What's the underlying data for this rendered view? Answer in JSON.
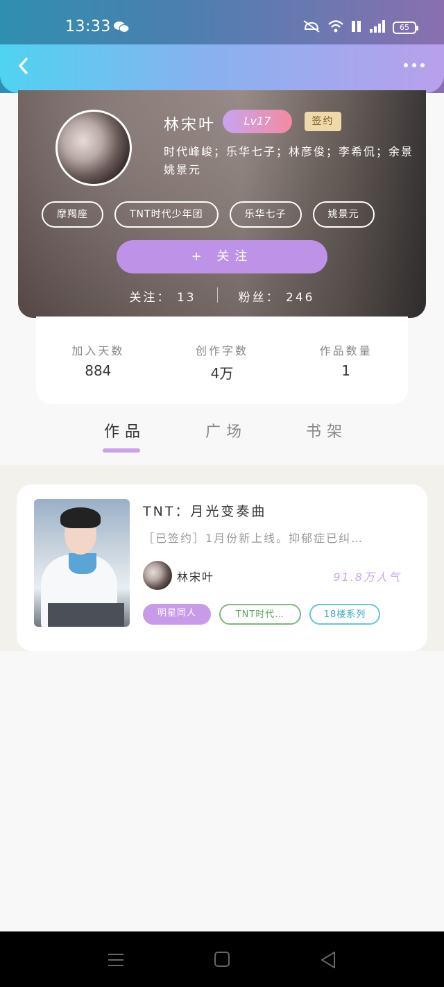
{
  "status_bar": {
    "time": "13:33",
    "battery": "65"
  },
  "profile": {
    "name": "林宋叶",
    "level": "Lv17",
    "sign_badge": "签约",
    "bio_line1": "时代峰峻；乐华七子；林彦俊；李希侃；余景",
    "bio_line2": "姚景元",
    "tags": [
      "摩羯座",
      "TNT时代少年团",
      "乐华七子",
      "姚景元"
    ],
    "follow_button": "+ 关注",
    "following": "关注： 13",
    "followers": "粉丝： 246"
  },
  "stats": [
    {
      "label": "加入天数",
      "value": "884"
    },
    {
      "label": "创作字数",
      "value": "4万"
    },
    {
      "label": "作品数量",
      "value": "1"
    }
  ],
  "tabs": [
    "作品",
    "广场",
    "书架"
  ],
  "work": {
    "title": "TNT：月光变奏曲",
    "description": "［已签约］1月份新上线。抑郁症已纠…",
    "author": "林宋叶",
    "popularity": "91.8万人气",
    "tags": [
      "明星同人",
      "TNT时代…",
      "18楼系列"
    ]
  }
}
